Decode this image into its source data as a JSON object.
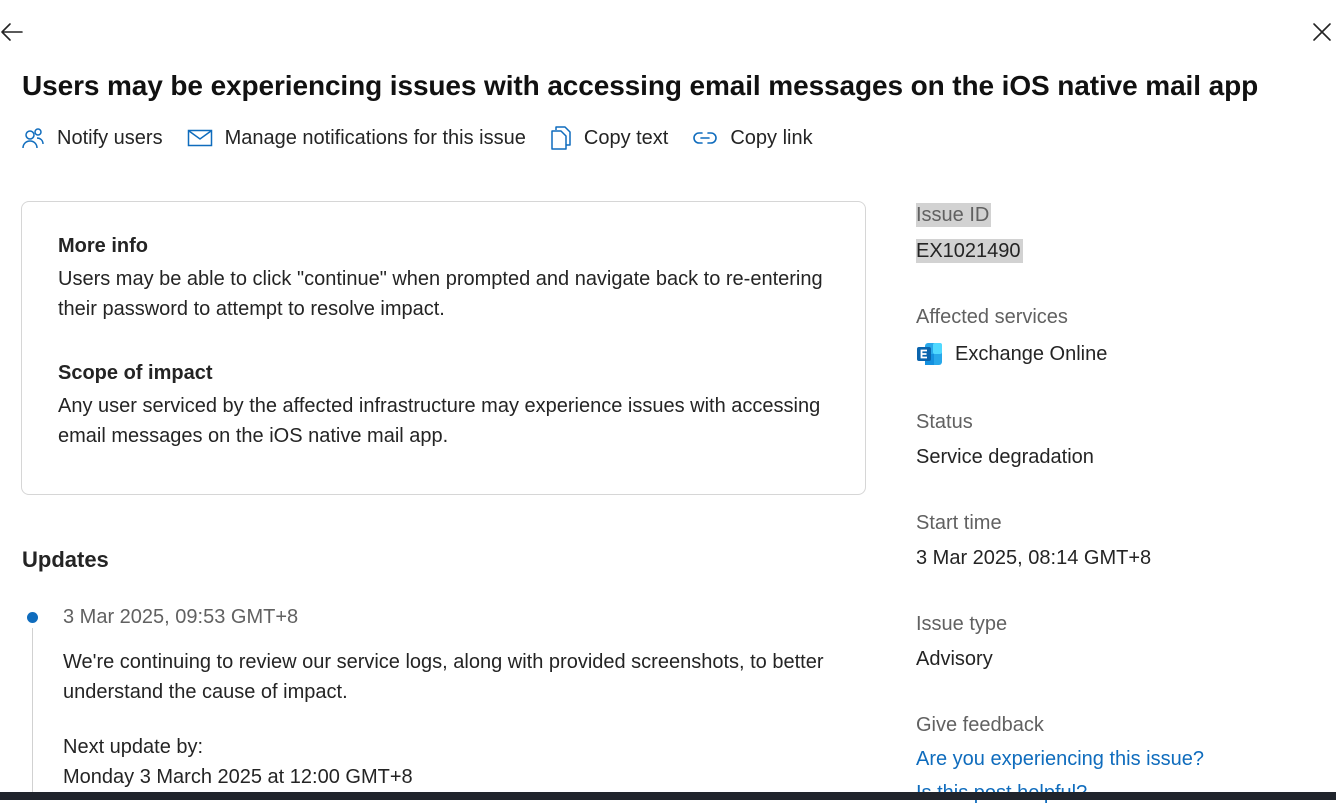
{
  "header": {
    "back_icon": "arrow-left-icon",
    "close_icon": "close-icon",
    "title": "Users may be experiencing issues with accessing email messages on the iOS native mail app"
  },
  "toolbar": {
    "items": [
      {
        "label": "Notify users",
        "icon": "people-icon"
      },
      {
        "label": "Manage notifications for this issue",
        "icon": "mail-icon"
      },
      {
        "label": "Copy text",
        "icon": "copy-icon"
      },
      {
        "label": "Copy link",
        "icon": "link-icon"
      }
    ]
  },
  "details": {
    "more_info_heading": "More info",
    "more_info_text": "Users may be able to click \"continue\" when prompted and navigate back to re-entering their password to attempt to resolve impact.",
    "scope_heading": "Scope of impact",
    "scope_text": "Any user serviced by the affected infrastructure may experience issues with accessing email messages on the iOS native mail app."
  },
  "updates": {
    "heading": "Updates",
    "items": [
      {
        "timestamp": "3 Mar 2025, 09:53 GMT+8",
        "body": "We're continuing to review our service logs, along with provided screenshots, to better understand the cause of impact.",
        "next_update_label": "Next update by:",
        "next_update_value": "Monday 3 March 2025 at 12:00 GMT+8"
      }
    ]
  },
  "sidebar": {
    "issue_id_label": "Issue ID",
    "issue_id": "EX1021490",
    "affected_services_label": "Affected services",
    "service_name": "Exchange Online",
    "service_icon": "exchange-icon",
    "status_label": "Status",
    "status": "Service degradation",
    "start_time_label": "Start time",
    "start_time": "3 Mar 2025, 08:14 GMT+8",
    "issue_type_label": "Issue type",
    "issue_type": "Advisory",
    "feedback_label": "Give feedback",
    "feedback_link": "Are you experiencing this issue?",
    "feedback_link_2": "Is this post helpful?"
  },
  "colors": {
    "accent": "#0f6cbd",
    "text": "#242424",
    "muted": "#616161",
    "highlight": "#d2d2d2",
    "border": "#d6d6d6"
  }
}
